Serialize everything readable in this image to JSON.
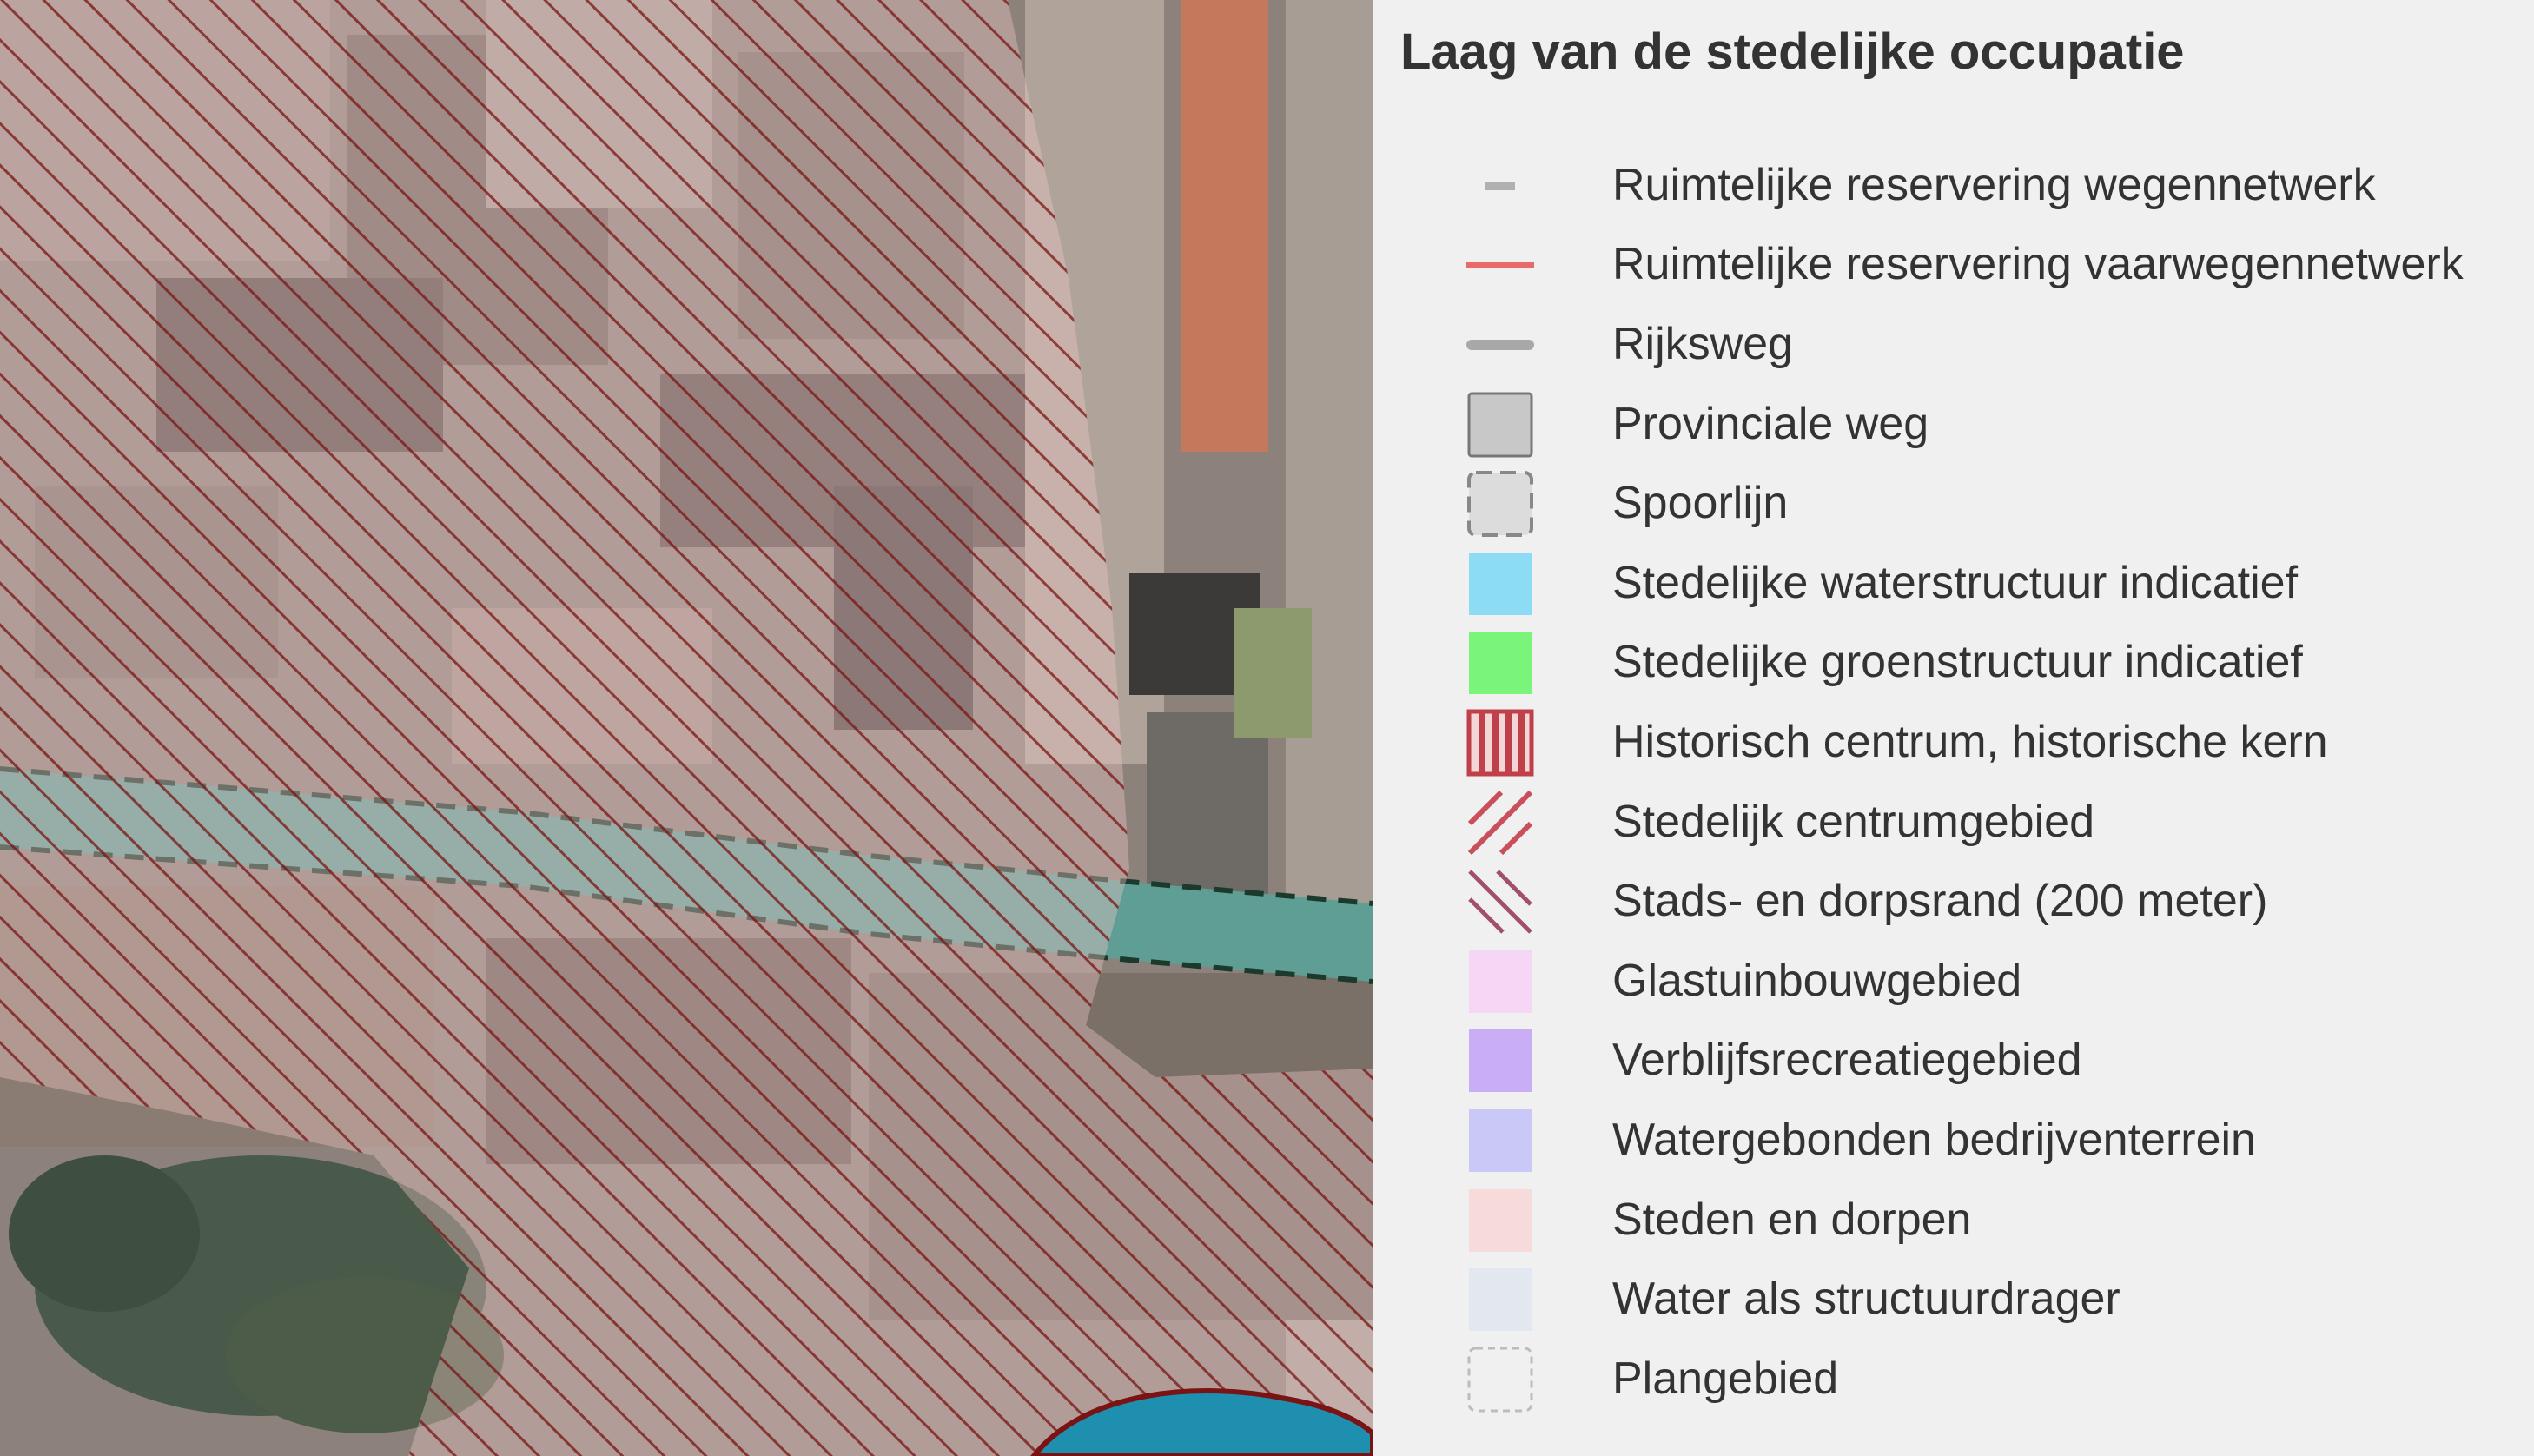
{
  "legend": {
    "title": "Laag van de stedelijke occupatie",
    "items": [
      {
        "label": "Ruimtelijke reservering wegennetwerk",
        "symbol": "short-gray-dash",
        "color": "#b0b0b0"
      },
      {
        "label": "Ruimtelijke reservering vaarwegennetwerk",
        "symbol": "red-line",
        "color": "#e86a6a"
      },
      {
        "label": "Rijksweg",
        "symbol": "thick-gray-line",
        "color": "#a8a8a8"
      },
      {
        "label": "Provinciale weg",
        "symbol": "gray-box",
        "color": "#c8c8c8"
      },
      {
        "label": "Spoorlijn",
        "symbol": "dashed-gray-box",
        "color": "#dcdcdc"
      },
      {
        "label": "Stedelijke waterstructuur indicatief",
        "symbol": "fill",
        "color": "#8ddcf5"
      },
      {
        "label": "Stedelijke groenstructuur indicatief",
        "symbol": "fill",
        "color": "#7af57a"
      },
      {
        "label": "Historisch centrum, historische kern",
        "symbol": "vertical-stripes",
        "color": "#c0404a"
      },
      {
        "label": "Stedelijk centrumgebied",
        "symbol": "forward-hatch",
        "color": "#c9505a"
      },
      {
        "label": "Stads- en dorpsrand (200 meter)",
        "symbol": "back-hatch",
        "color": "#a0506a"
      },
      {
        "label": "Glastuinbouwgebied",
        "symbol": "fill",
        "color": "#f5d6f5"
      },
      {
        "label": "Verblijfsrecreatiegebied",
        "symbol": "fill",
        "color": "#c9aef5"
      },
      {
        "label": "Watergebonden bedrijventerrein",
        "symbol": "fill",
        "color": "#cac8f7"
      },
      {
        "label": "Steden en dorpen",
        "symbol": "fill",
        "color": "#f7dada"
      },
      {
        "label": "Water als structuurdrager",
        "symbol": "fill",
        "color": "#e3e7ef"
      },
      {
        "label": "Plangebied",
        "symbol": "dashed-outline",
        "color": "#bcbcbc"
      }
    ]
  },
  "map": {
    "hatch_color": "#7a1414",
    "overlay_color": "#f1c8c8",
    "water_color": "#58b8c8",
    "canal_color": "#5e9e94"
  }
}
